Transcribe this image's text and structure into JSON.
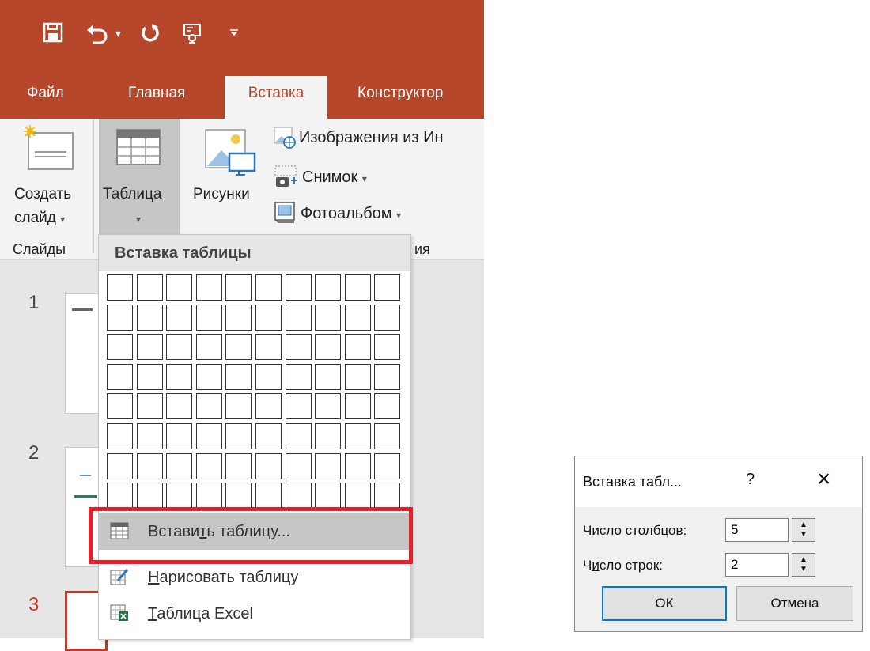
{
  "ribbon_tabs": [
    "Файл",
    "Главная",
    "Вставка",
    "Конструктор"
  ],
  "ribbon": {
    "new_slide_l1": "Создать",
    "new_slide_l2": "слайд",
    "table_label": "Таблица",
    "pictures_label": "Рисунки",
    "online_images": "Изображения из Ин",
    "screenshot": "Снимок",
    "photo_album": "Фотоальбом",
    "group_slides": "Слайды",
    "group_images_partial": "ия"
  },
  "slides": [
    "1",
    "2",
    "3"
  ],
  "dropdown": {
    "title": "Вставка таблицы",
    "grid_cols": 10,
    "grid_rows": 8,
    "items": [
      {
        "pre": "Встави",
        "mnemonic": "т",
        "post": "ь таблицу..."
      },
      {
        "pre": "",
        "mnemonic": "Н",
        "post": "арисовать таблицу"
      },
      {
        "pre": "",
        "mnemonic": "Т",
        "post": "аблица Excel"
      }
    ]
  },
  "dialog": {
    "title": "Вставка табл...",
    "help": "?",
    "close": "×",
    "columns_label_mnemonic": "Ч",
    "columns_label_rest": "исло столбцов:",
    "columns_value": "5",
    "rows_label_pre": "Ч",
    "rows_label_mnemonic": "и",
    "rows_label_post": "сло строк:",
    "rows_value": "2",
    "ok": "ОК",
    "cancel": "Отмена"
  },
  "colors": {
    "accent": "#b7472a",
    "highlight": "#e5202b",
    "ok_border": "#0078d7"
  }
}
